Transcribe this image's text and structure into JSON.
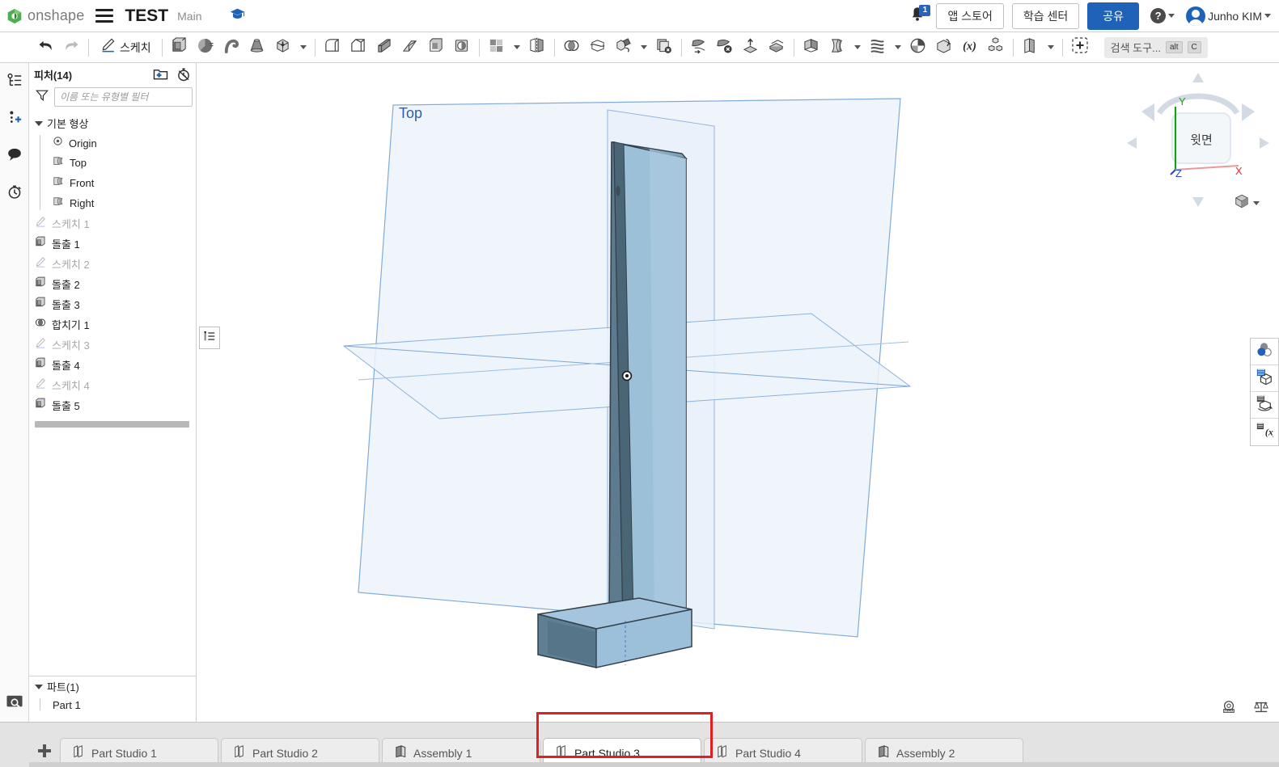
{
  "header": {
    "logo_text": "onshape",
    "logo_icon": "onshape-logo-icon",
    "menu_icon": "hamburger-menu-icon",
    "document_title": "TEST",
    "workspace": "Main",
    "learning_icon": "graduation-cap-icon",
    "bell_icon": "notification-bell-icon",
    "notification_count": "1",
    "app_store_label": "앱 스토어",
    "learning_center_label": "학습 센터",
    "share_label": "공유",
    "help_icon": "question-mark-icon",
    "user_name": "Junho KIM",
    "avatar_icon": "user-avatar-icon"
  },
  "toolbar": {
    "undo_icon": "undo-arrow-icon",
    "redo_icon": "redo-arrow-icon",
    "sketch_icon": "pencil-sketch-icon",
    "sketch_label": "스케치",
    "items": [
      {
        "name": "extrude-icon"
      },
      {
        "name": "revolve-icon"
      },
      {
        "name": "sweep-icon"
      },
      {
        "name": "loft-icon"
      },
      {
        "name": "thicken-icon"
      },
      {
        "name": "fillet-icon"
      },
      {
        "name": "chamfer-icon"
      },
      {
        "name": "rib-icon"
      },
      {
        "name": "draft-icon"
      },
      {
        "name": "shell-icon"
      },
      {
        "name": "hole-icon"
      },
      {
        "name": "pattern-icon"
      },
      {
        "name": "mirror-icon"
      },
      {
        "name": "boolean-icon"
      },
      {
        "name": "split-icon"
      },
      {
        "name": "transform-icon"
      },
      {
        "name": "move-face-icon"
      },
      {
        "name": "delete-face-icon"
      },
      {
        "name": "replace-face-icon"
      },
      {
        "name": "delete-part-icon"
      },
      {
        "name": "offset-surface-icon"
      },
      {
        "name": "enclose-icon"
      },
      {
        "name": "sheet-metal-icon"
      },
      {
        "name": "plane-icon"
      },
      {
        "name": "curve-icon"
      },
      {
        "name": "composite-part-icon"
      },
      {
        "name": "variable-icon"
      },
      {
        "name": "assembly-insert-icon"
      },
      {
        "name": "import-icon"
      },
      {
        "name": "add-custom-feature-icon"
      }
    ],
    "search_tools_label": "검색 도구...",
    "kbd_alt": "alt",
    "kbd_c": "C"
  },
  "rail": {
    "items": [
      {
        "name": "feature-list-icon"
      },
      {
        "name": "add-variable-icon"
      },
      {
        "name": "comments-icon"
      },
      {
        "name": "history-icon"
      }
    ],
    "bottom": {
      "name": "zoom-search-icon"
    }
  },
  "panel": {
    "title": "피처(14)",
    "new_folder_icon": "new-folder-icon",
    "rollback_timer_icon": "rollback-timer-icon",
    "filter_icon": "filter-funnel-icon",
    "filter_placeholder": "이름 또는 유형별 필터",
    "default_geometry": {
      "label": "기본 형상",
      "items": [
        {
          "label": "Origin",
          "icon": "origin-icon",
          "dim": false
        },
        {
          "label": "Top",
          "icon": "plane-icon",
          "dim": false
        },
        {
          "label": "Front",
          "icon": "plane-icon",
          "dim": false
        },
        {
          "label": "Right",
          "icon": "plane-icon",
          "dim": false
        }
      ]
    },
    "features": [
      {
        "label": "스케치 1",
        "icon": "sketch-icon",
        "dim": true
      },
      {
        "label": "돌출 1",
        "icon": "extrude-icon",
        "dim": false
      },
      {
        "label": "스케치 2",
        "icon": "sketch-icon",
        "dim": true
      },
      {
        "label": "돌출 2",
        "icon": "extrude-icon",
        "dim": false
      },
      {
        "label": "돌출 3",
        "icon": "extrude-icon",
        "dim": false
      },
      {
        "label": "합치기 1",
        "icon": "boolean-icon",
        "dim": false
      },
      {
        "label": "스케치 3",
        "icon": "sketch-icon",
        "dim": true
      },
      {
        "label": "돌출 4",
        "icon": "extrude-icon",
        "dim": false
      },
      {
        "label": "스케치 4",
        "icon": "sketch-icon",
        "dim": true
      },
      {
        "label": "돌출 5",
        "icon": "extrude-icon",
        "dim": false
      }
    ],
    "parts": {
      "label": "파트(1)",
      "items": [
        {
          "label": "Part 1"
        }
      ]
    }
  },
  "viewport": {
    "plane_label": "Top",
    "plane_label_color": "#2a5db0",
    "plane_fill": "#eaf2fb",
    "plane_stroke": "#7ba7d7",
    "part_fill_light": "#a7c6dd",
    "part_fill_mid": "#8fb5d0",
    "part_fill_dark": "#6d8ea6",
    "part_stroke": "#33414b",
    "float_list_icon": "feature-list-small-icon",
    "measure_icon": "measure-tape-icon",
    "mass_icon": "mass-properties-icon"
  },
  "viewcube": {
    "face_label": "윗면",
    "axis_x": "X",
    "axis_y": "Y",
    "axis_z": "Z",
    "axis_x_color": "#e03030",
    "axis_y_color": "#15a015",
    "axis_z_color": "#2a40d0",
    "perspective_icon": "view-cube-perspective-icon"
  },
  "right_tools": {
    "items": [
      {
        "name": "appearance-icon"
      },
      {
        "name": "section-view-icon"
      },
      {
        "name": "rotate-section-icon"
      },
      {
        "name": "variable-display-icon"
      }
    ]
  },
  "tabs": {
    "add_icon": "add-tab-icon",
    "items": [
      {
        "label": "Part Studio 1",
        "icon": "part-studio-icon",
        "active": false,
        "highlighted": false
      },
      {
        "label": "Part Studio 2",
        "icon": "part-studio-icon",
        "active": false,
        "highlighted": false
      },
      {
        "label": "Assembly 1",
        "icon": "assembly-icon",
        "active": false,
        "highlighted": false
      },
      {
        "label": "Part Studio 3",
        "icon": "part-studio-icon",
        "active": true,
        "highlighted": true
      },
      {
        "label": "Part Studio 4",
        "icon": "part-studio-icon",
        "active": false,
        "highlighted": false
      },
      {
        "label": "Assembly 2",
        "icon": "assembly-icon",
        "active": false,
        "highlighted": false
      }
    ],
    "highlight_color": "#e02020"
  }
}
